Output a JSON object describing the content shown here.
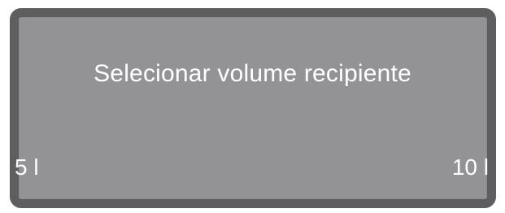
{
  "display": {
    "prompt": "Selecionar volume recipiente",
    "softkeys": {
      "left_label": "5 l",
      "right_label": "10 l"
    }
  },
  "colors": {
    "screen_background": "#939395",
    "frame": "#5e5e61",
    "text": "#ffffff"
  }
}
